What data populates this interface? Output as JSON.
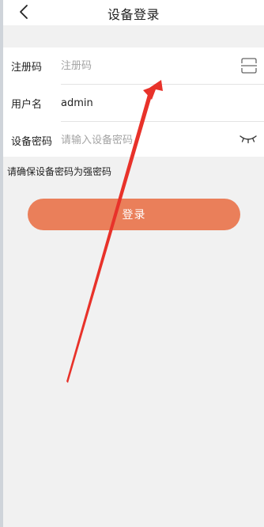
{
  "header": {
    "title": "设备登录",
    "back_icon": "chevron-left-icon"
  },
  "form": {
    "registration": {
      "label": "注册码",
      "placeholder": "注册码",
      "value": "",
      "scan_icon": "scan-icon"
    },
    "username": {
      "label": "用户名",
      "value": "admin"
    },
    "password": {
      "label": "设备密码",
      "placeholder": "请输入设备密码",
      "value": "",
      "toggle_icon": "eye-closed-icon"
    }
  },
  "hint": "请确保设备密码为强密码",
  "login_button": "登录",
  "colors": {
    "accent": "#ea7f5a",
    "annotation_arrow": "#e8322a",
    "background": "#f1f1f1"
  }
}
